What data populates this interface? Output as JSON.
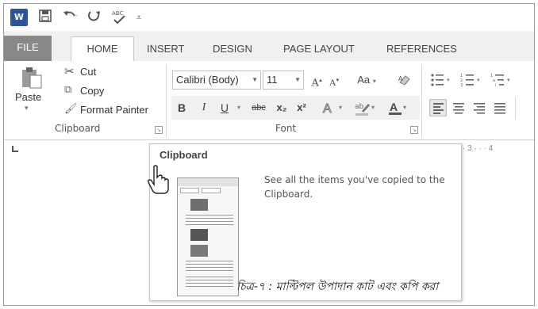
{
  "qat": {
    "word_icon": "W",
    "save_icon": "save-icon",
    "undo_icon": "undo-icon",
    "redo_icon": "redo-icon",
    "spelling_icon": "spelling-icon",
    "customize_icon": "customize-icon"
  },
  "tabs": [
    "FILE",
    "HOME",
    "INSERT",
    "DESIGN",
    "PAGE LAYOUT",
    "REFERENCES"
  ],
  "clipboard_group": {
    "paste_label": "Paste",
    "cut_label": "Cut",
    "copy_label": "Copy",
    "format_painter_label": "Format Painter",
    "group_label": "Clipboard"
  },
  "font_group": {
    "font_name": "Calibri (Body)",
    "font_size": "11",
    "grow_font": "A",
    "shrink_font": "A",
    "change_case": "Aa",
    "bold": "B",
    "italic": "I",
    "underline": "U",
    "strikethrough": "abc",
    "subscript": "x₂",
    "superscript": "x²",
    "group_label": "Font"
  },
  "ruler": {
    "numbers": "· 3 · · · 4"
  },
  "tooltip": {
    "title": "Clipboard",
    "description": "See all the items you've copied to the Clipboard."
  },
  "caption": "চিত্র-৭ : মাল্টিপল উপাদান কাট এবং কপি করা",
  "colors": {
    "file_tab": "#888888",
    "ribbon_bg": "#ffffff",
    "tabs_bg": "#f0f0f0"
  }
}
